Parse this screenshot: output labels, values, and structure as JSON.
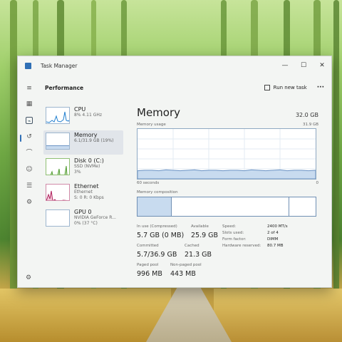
{
  "window": {
    "title": "Task Manager",
    "minimize": "—",
    "maximize": "☐",
    "close": "✕"
  },
  "header": {
    "page": "Performance",
    "run_new_task": "Run new task",
    "more": "···"
  },
  "nav": {
    "icons": [
      "hamburger-icon",
      "processes-icon",
      "performance-icon",
      "app-history-icon",
      "startup-apps-icon",
      "users-icon",
      "details-icon",
      "services-icon"
    ],
    "settings_icon": "settings-icon"
  },
  "devices": [
    {
      "name": "CPU",
      "sub1": "8%  4.11 GHz",
      "sub2": "",
      "color": "#1f7ecf"
    },
    {
      "name": "Memory",
      "sub1": "6.1/31.9 GB (19%)",
      "sub2": "",
      "color": "#6b93c4"
    },
    {
      "name": "Disk 0 (C:)",
      "sub1": "SSD (NVMe)",
      "sub2": "3%",
      "color": "#4e9a2d"
    },
    {
      "name": "Ethernet",
      "sub1": "Ethernet",
      "sub2": "S: 0  R: 0 Kbps",
      "color": "#b0235f"
    },
    {
      "name": "GPU 0",
      "sub1": "NVIDIA GeForce R...",
      "sub2": "0%  (37 °C)",
      "color": "#6b93c4"
    }
  ],
  "memory": {
    "title": "Memory",
    "total": "32.0 GB",
    "usage_label": "Memory usage",
    "usage_max": "31.9 GB",
    "graph_span": "60 seconds",
    "graph_min": "0",
    "composition_label": "Memory composition",
    "usage_fraction": 0.19,
    "composition_in_use_fraction": 0.19,
    "stats": {
      "in_use_label": "In use (Compressed)",
      "in_use_value": "5.7 GB (0 MB)",
      "available_label": "Available",
      "available_value": "25.9 GB",
      "committed_label": "Committed",
      "committed_value": "5.7/36.9 GB",
      "cached_label": "Cached",
      "cached_value": "21.3 GB",
      "paged_label": "Paged pool",
      "paged_value": "996 MB",
      "nonpaged_label": "Non-paged pool",
      "nonpaged_value": "443 MB"
    },
    "details": [
      {
        "key": "Speed:",
        "value": "2400 MT/s"
      },
      {
        "key": "Slots used:",
        "value": "2 of 4"
      },
      {
        "key": "Form factor:",
        "value": "DIMM"
      },
      {
        "key": "Hardware reserved:",
        "value": "80.7 MB"
      }
    ]
  },
  "colors": {
    "accent": "#2f6fb5",
    "mem_fill": "#c8dbef",
    "mem_line": "#6b93c4"
  }
}
